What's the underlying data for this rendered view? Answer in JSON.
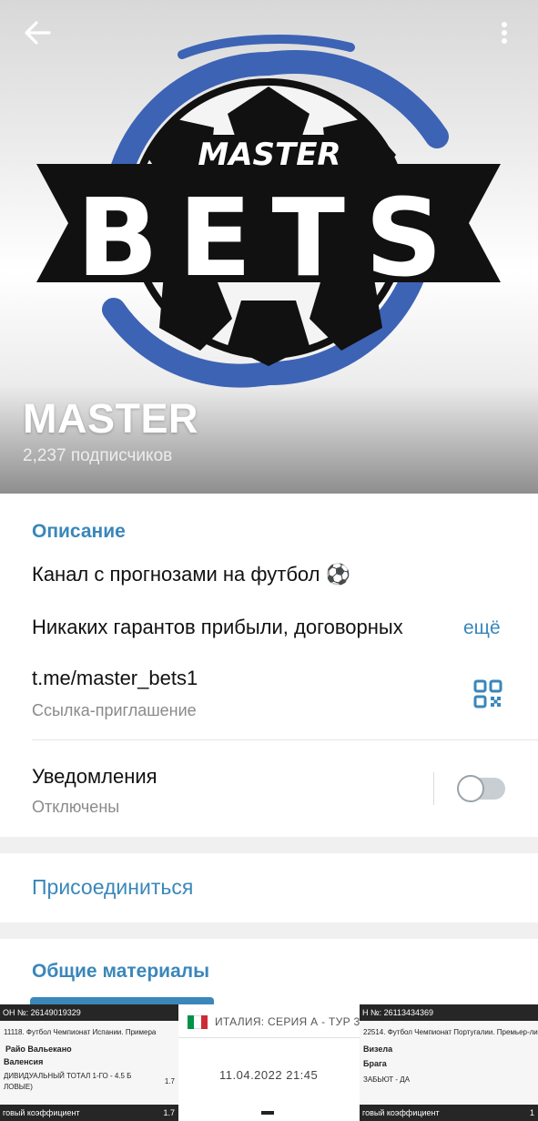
{
  "header": {
    "channel_name": "MASTER",
    "subscribers": "2,237 подписчиков",
    "logo": {
      "small_text": "MASTER",
      "big_text": "BETS"
    }
  },
  "info": {
    "description_label": "Описание",
    "description_line1": "Канал с прогнозами на футбол ⚽",
    "description_line2": "Никаких гарантов прибыли, договорных",
    "more_label": "ещё",
    "link": "t.me/master_bets1",
    "link_caption": "Ссылка-приглашение",
    "notifications_label": "Уведомления",
    "notifications_status": "Отключены",
    "notifications_enabled": false
  },
  "join": {
    "label": "Присоединиться"
  },
  "media": {
    "title": "Общие материалы",
    "thumb1": {
      "bar": "ОН №: 26149019329",
      "event": "11118. Футбол Чемпионат Испании. Примера",
      "team1": "Райо Вальекано",
      "team2": "Валенсия",
      "bet": "ДИВИДУАЛЬНЫЙ ТОТАЛ 1-ГО - 4.5 Б",
      "bet_extra": "ЛОВЫЕ)",
      "odds": "1.7",
      "total_label": "говый коэффициент",
      "total_value": "1.7"
    },
    "thumb2": {
      "title": "ИТАЛИЯ: СЕРИЯ А - ТУР 3",
      "datetime": "11.04.2022 21:45",
      "flag_colors": [
        "#009246",
        "#ffffff",
        "#ce2b37"
      ]
    },
    "thumb3": {
      "bar": "Н №: 26113434369",
      "event": "22514. Футбол Чемпионат Португалии. Премьер-ли",
      "team1": "Визела",
      "team2": "Брага",
      "bet": "ЗАБЬЮТ - ДА",
      "total_label": "говый коэффициент",
      "total_value": "1"
    }
  },
  "colors": {
    "accent": "#3a87ba",
    "logo_blue": "#3d63b5"
  }
}
